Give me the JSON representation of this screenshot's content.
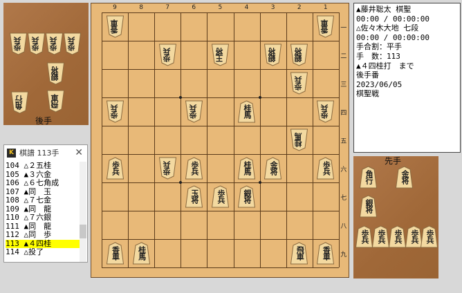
{
  "info": {
    "lines": [
      "▲藤井聡太 棋聖",
      "00:00 / 00:00:00",
      "△佐々木大地 七段",
      "00:00 / 00:00:00",
      "手合割：平手",
      "手　数：113",
      "▲４四桂打　まで",
      "後手番",
      "2023/06/05",
      "棋聖戦"
    ]
  },
  "stands": {
    "gote_label": "後手",
    "sente_label": "先手"
  },
  "kifu": {
    "title": "棋譜 113手",
    "icon": "K",
    "close": "✕",
    "moves": [
      "104 △２五桂",
      "105 ▲３六金",
      "106 △６七角成",
      "107 ▲同　玉",
      "108 △７七金",
      "109 ▲同　龍",
      "110 △７六銀",
      "111 ▲同　龍",
      "112 △同　歩",
      "113 ▲４四桂",
      "114 △投了"
    ],
    "selected_index": 9
  },
  "board": {
    "col_labels": [
      "9",
      "8",
      "7",
      "6",
      "5",
      "4",
      "3",
      "2",
      "1"
    ],
    "row_labels": [
      "一",
      "二",
      "三",
      "四",
      "五",
      "六",
      "七",
      "八",
      "九"
    ],
    "pieces": [
      {
        "col": 9,
        "row": 1,
        "text": "香車",
        "side": "gote",
        "promo": false
      },
      {
        "col": 1,
        "row": 1,
        "text": "香車",
        "side": "gote",
        "promo": false
      },
      {
        "col": 7,
        "row": 2,
        "text": "歩兵",
        "side": "gote",
        "promo": false
      },
      {
        "col": 5,
        "row": 2,
        "text": "王将",
        "side": "gote",
        "promo": false
      },
      {
        "col": 3,
        "row": 2,
        "text": "銀将",
        "side": "gote",
        "promo": false
      },
      {
        "col": 2,
        "row": 2,
        "text": "銀将",
        "side": "gote",
        "promo": false
      },
      {
        "col": 2,
        "row": 3,
        "text": "歩兵",
        "side": "gote",
        "promo": false
      },
      {
        "col": 9,
        "row": 4,
        "text": "歩兵",
        "side": "gote",
        "promo": false
      },
      {
        "col": 6,
        "row": 4,
        "text": "歩兵",
        "side": "gote",
        "promo": false
      },
      {
        "col": 4,
        "row": 4,
        "text": "桂馬",
        "side": "sente",
        "promo": false
      },
      {
        "col": 1,
        "row": 4,
        "text": "歩兵",
        "side": "gote",
        "promo": false
      },
      {
        "col": 2,
        "row": 5,
        "text": "桂馬",
        "side": "gote",
        "promo": false
      },
      {
        "col": 9,
        "row": 6,
        "text": "歩兵",
        "side": "sente",
        "promo": false
      },
      {
        "col": 7,
        "row": 6,
        "text": "歩兵",
        "side": "gote",
        "promo": false
      },
      {
        "col": 6,
        "row": 6,
        "text": "歩兵",
        "side": "sente",
        "promo": false
      },
      {
        "col": 4,
        "row": 6,
        "text": "桂馬",
        "side": "sente",
        "promo": false
      },
      {
        "col": 3,
        "row": 6,
        "text": "金将",
        "side": "sente",
        "promo": false
      },
      {
        "col": 1,
        "row": 6,
        "text": "歩兵",
        "side": "sente",
        "promo": false
      },
      {
        "col": 6,
        "row": 7,
        "text": "玉将",
        "side": "sente",
        "promo": false
      },
      {
        "col": 5,
        "row": 7,
        "text": "歩兵",
        "side": "sente",
        "promo": false
      },
      {
        "col": 4,
        "row": 7,
        "text": "銀将",
        "side": "sente",
        "promo": false
      },
      {
        "col": 9,
        "row": 9,
        "text": "香車",
        "side": "sente",
        "promo": false
      },
      {
        "col": 8,
        "row": 9,
        "text": "桂馬",
        "side": "sente",
        "promo": false
      },
      {
        "col": 2,
        "row": 9,
        "text": "飛車",
        "side": "sente",
        "promo": false
      },
      {
        "col": 1,
        "row": 9,
        "text": "香車",
        "side": "sente",
        "promo": false
      }
    ]
  },
  "gote_hand": [
    {
      "text": "歩兵",
      "slot": "a"
    },
    {
      "text": "歩兵",
      "slot": "b"
    },
    {
      "text": "歩兵",
      "slot": "c"
    },
    {
      "text": "歩兵",
      "slot": "d"
    },
    {
      "text": "銀将",
      "slot": "e"
    },
    {
      "text": "角行",
      "slot": "f"
    },
    {
      "text": "飛車",
      "slot": "g"
    }
  ],
  "sente_hand": [
    {
      "text": "角行",
      "slot": "a"
    },
    {
      "text": "金将",
      "slot": "b"
    },
    {
      "text": "銀将",
      "slot": "c"
    },
    {
      "text": "歩兵",
      "slot": "d"
    },
    {
      "text": "歩兵",
      "slot": "e"
    },
    {
      "text": "歩兵",
      "slot": "f"
    },
    {
      "text": "歩兵",
      "slot": "g"
    },
    {
      "text": "歩兵",
      "slot": "h"
    }
  ],
  "colors": {
    "board": "#e8b978",
    "stand": "#a8703f",
    "selection": "#ffff00",
    "promoted_text": "#b00000"
  }
}
